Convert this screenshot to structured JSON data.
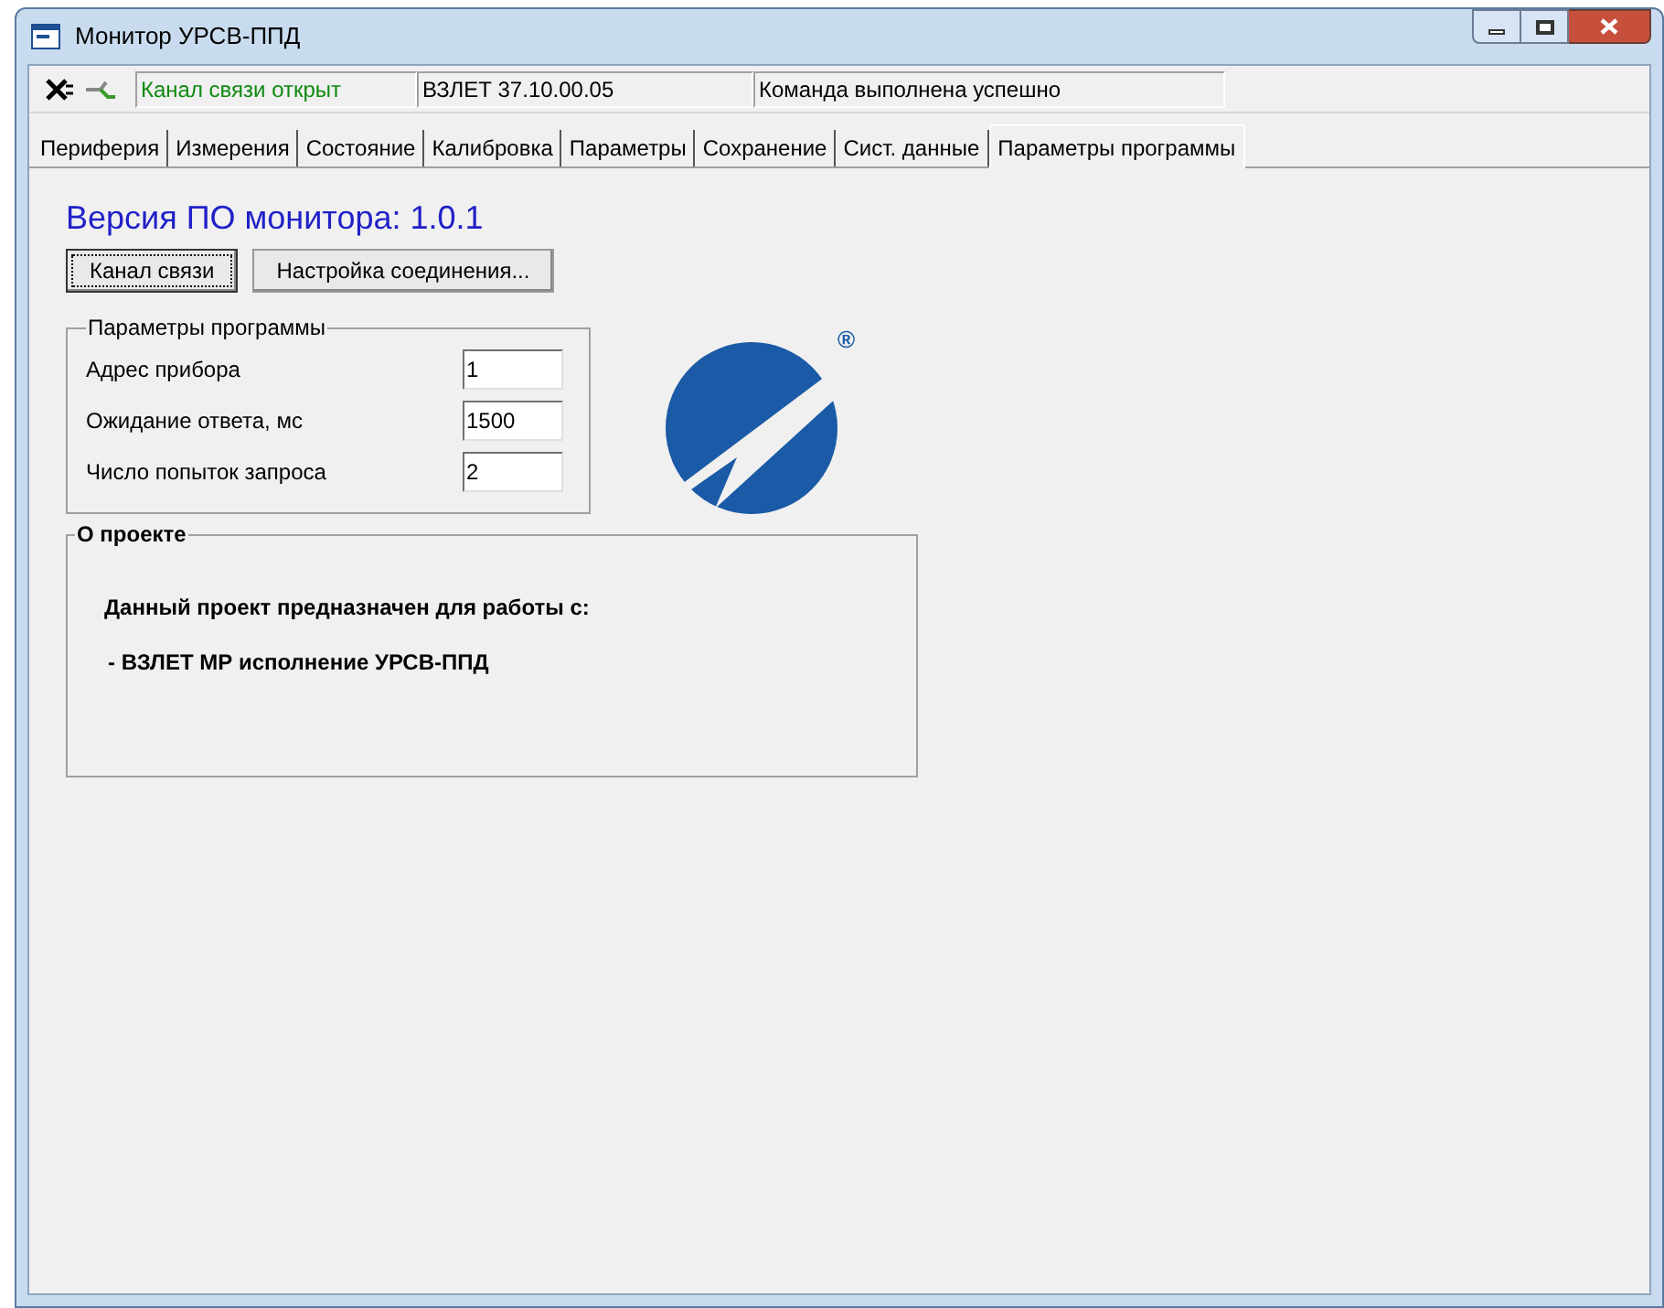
{
  "window": {
    "title": "Монитор УРСВ-ППД"
  },
  "status": [
    {
      "text": "Канал связи открыт",
      "kind": "ok"
    },
    {
      "text": "ВЗЛЕТ 37.10.00.05",
      "kind": "plain"
    },
    {
      "text": "Команда выполнена успешно",
      "kind": "plain"
    }
  ],
  "tabs": [
    {
      "label": "Периферия",
      "selected": false
    },
    {
      "label": "Измерения",
      "selected": false
    },
    {
      "label": "Состояние",
      "selected": false
    },
    {
      "label": "Калибровка",
      "selected": false
    },
    {
      "label": "Параметры",
      "selected": false
    },
    {
      "label": "Сохранение",
      "selected": false
    },
    {
      "label": "Сист. данные",
      "selected": false
    },
    {
      "label": "Параметры программы",
      "selected": true
    }
  ],
  "version": "Версия ПО монитора: 1.0.1",
  "buttons": [
    {
      "label": "Канал связи",
      "focused": true
    },
    {
      "label": "Настройка соединения...",
      "focused": false
    }
  ],
  "params": {
    "title": "Параметры программы",
    "fields": [
      {
        "label": "Адрес прибора",
        "value": "1"
      },
      {
        "label": "Ожидание ответа, мс",
        "value": "1500"
      },
      {
        "label": "Число попыток запроса",
        "value": "2"
      }
    ]
  },
  "about": {
    "title": "О проекте",
    "lines": [
      "Данный проект предназначен для работы с:",
      "- ВЗЛЕТ МР исполнение УРСВ-ППД"
    ]
  },
  "logo": {
    "mark": "®"
  }
}
